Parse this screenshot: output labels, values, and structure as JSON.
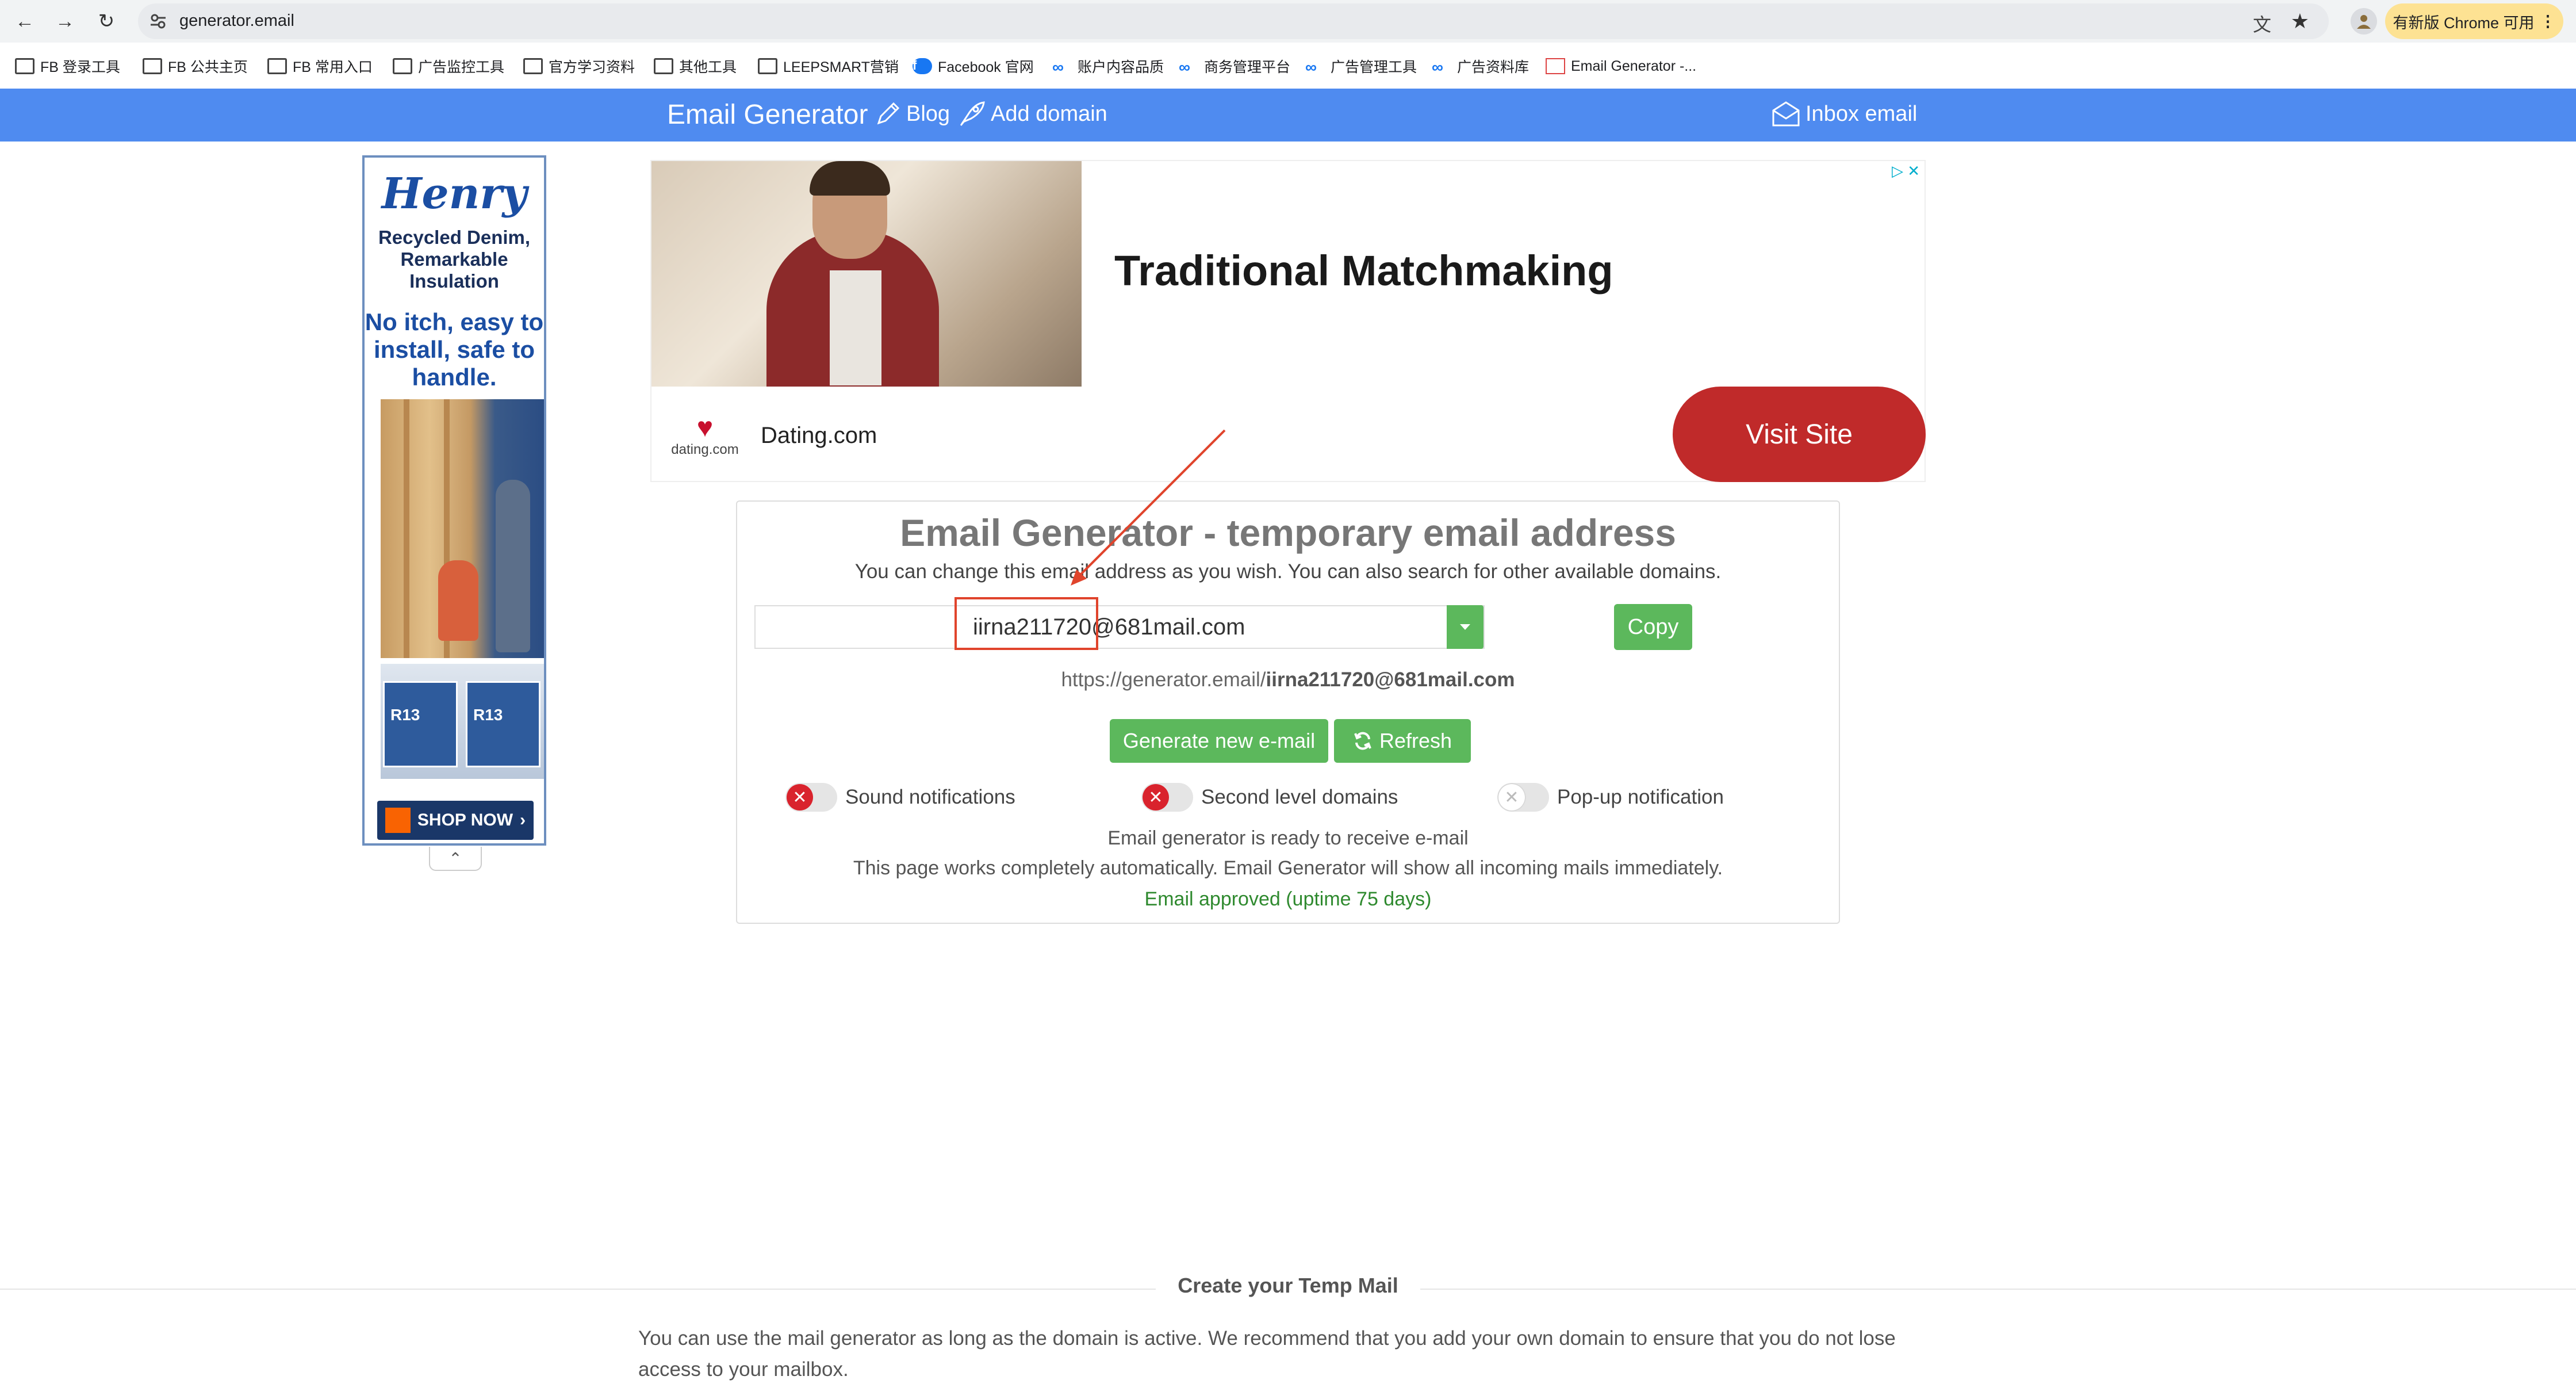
{
  "browser": {
    "url": "generator.email",
    "update_chip": "有新版 Chrome 可用",
    "bookmarks": [
      {
        "label": "FB 登录工具",
        "icon": "folder-icon"
      },
      {
        "label": "FB 公共主页",
        "icon": "folder-icon"
      },
      {
        "label": "FB 常用入口",
        "icon": "folder-icon"
      },
      {
        "label": "广告监控工具",
        "icon": "folder-icon"
      },
      {
        "label": "官方学习资料",
        "icon": "folder-icon"
      },
      {
        "label": "其他工具",
        "icon": "folder-icon"
      },
      {
        "label": "LEEPSMART营销",
        "icon": "folder-icon"
      },
      {
        "label": "Facebook 官网",
        "icon": "facebook-icon"
      },
      {
        "label": "账户内容品质",
        "icon": "meta-icon"
      },
      {
        "label": "商务管理平台",
        "icon": "meta-icon"
      },
      {
        "label": "广告管理工具",
        "icon": "meta-icon"
      },
      {
        "label": "广告资料库",
        "icon": "meta-icon"
      },
      {
        "label": "Email Generator -...",
        "icon": "email-generator-icon"
      }
    ]
  },
  "header": {
    "brand": "Email Generator",
    "blog": "Blog",
    "add_domain": "Add domain",
    "inbox": "Inbox email",
    "color": "#4f8bf0"
  },
  "side_ad": {
    "logo": "Henry",
    "tagline": "Recycled Denim, Remarkable Insulation",
    "subline": "No itch, easy to install, safe to handle.",
    "pack_label": "R13",
    "cta": "SHOP NOW"
  },
  "banner_ad": {
    "headline": "Traditional Matchmaking",
    "brand_logo": "dating.com",
    "brand_name": "Dating.com",
    "cta": "Visit Site",
    "cta_color": "#c02a2a"
  },
  "main": {
    "title": "Email Generator - temporary email address",
    "subtitle": "You can change this email address as you wish. You can also search for other available domains.",
    "email_value": "iirna211720@681mail.com",
    "copy_label": "Copy",
    "url_prefix": "https://generator.email/",
    "url_email": "iirna211720@681mail.com",
    "generate_label": "Generate new e-mail",
    "refresh_label": "Refresh",
    "toggles": [
      {
        "label": "Sound notifications",
        "state": "off-red"
      },
      {
        "label": "Second level domains",
        "state": "off-red"
      },
      {
        "label": "Pop-up notification",
        "state": "off-gray"
      }
    ],
    "status_ready": "Email generator is ready to receive e-mail",
    "status_auto": "This page works completely automatically. Email Generator will show all incoming mails immediately.",
    "status_approved": "Email approved (uptime 75 days)",
    "accent_color": "#5cb85c"
  },
  "footer_section": {
    "title": "Create your Temp Mail",
    "text": "You can use the mail generator as long as the domain is active. We recommend that you add your own domain to ensure that you do not lose access to your mailbox."
  }
}
